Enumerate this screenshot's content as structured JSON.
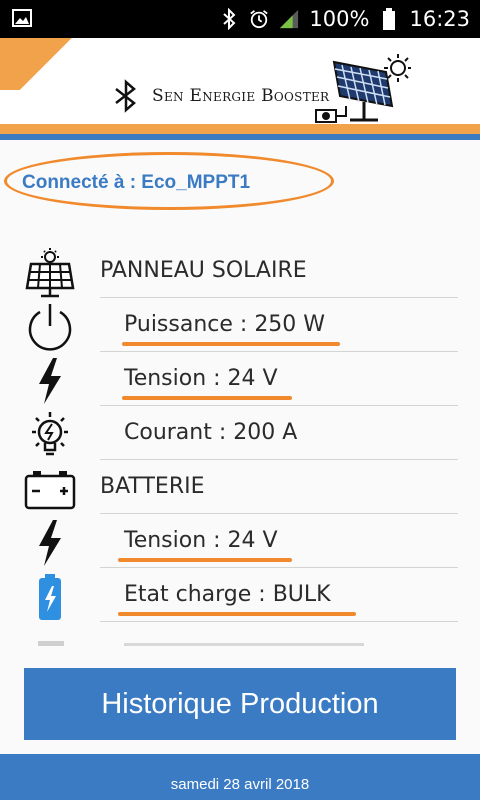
{
  "status_bar": {
    "battery_percent": "100%",
    "time": "16:23",
    "icons": [
      "image-icon",
      "bluetooth-icon",
      "alarm-icon",
      "signal-icon",
      "battery-icon"
    ]
  },
  "header": {
    "app_title": "Sen Energie Booster",
    "logo_icon": "bluetooth-icon",
    "illustration": "solar-panel-icon"
  },
  "connection": {
    "label": "Connecté à : Eco_MPPT1"
  },
  "rows": [
    {
      "type": "section",
      "icon": "solar-panel-icon",
      "label": "PANNEAU SOLAIRE",
      "highlight": false
    },
    {
      "type": "item",
      "icon": "power-icon",
      "label": "Puissance : 250  W",
      "highlight": true
    },
    {
      "type": "item",
      "icon": "lightning-icon",
      "label": "Tension : 24  V",
      "highlight": true
    },
    {
      "type": "item",
      "icon": "lightbulb-icon",
      "label": "Courant : 200  A",
      "highlight": false
    },
    {
      "type": "section",
      "icon": "battery-icon",
      "label": "BATTERIE",
      "highlight": false
    },
    {
      "type": "item",
      "icon": "lightning-icon",
      "label": "Tension : 24  V",
      "highlight": true
    },
    {
      "type": "item",
      "icon": "battery-charge-icon",
      "label": "Etat charge :   BULK",
      "highlight": true
    }
  ],
  "history_button": {
    "label": "Historique Production"
  },
  "footer": {
    "date": "samedi 28 avril 2018"
  },
  "colors": {
    "accent": "#3a7bc4",
    "highlight": "#f08a2c",
    "header_orange": "#f2a24a"
  }
}
